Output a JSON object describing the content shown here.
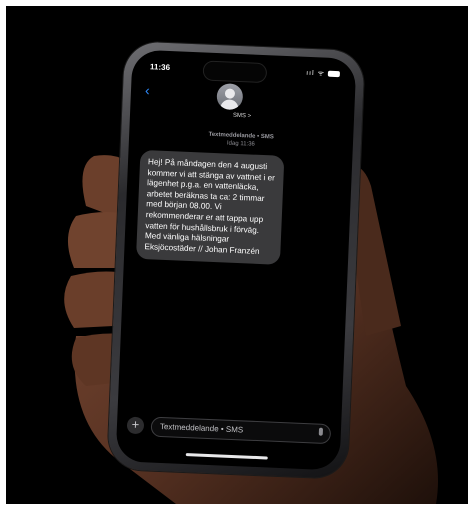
{
  "status_bar": {
    "time": "11:36",
    "icons": "ııl ᯤ"
  },
  "header": {
    "back_icon": "chevron-left-icon",
    "contact_name": "SMS >"
  },
  "thread": {
    "channel": "Textmeddelande • SMS",
    "timestamp": "Idag 11:36"
  },
  "message": {
    "text": "Hej! På måndagen den 4 augusti kommer vi att stänga av vattnet i er lägenhet p.g.a. en vattenläcka, arbetet beräknas ta ca: 2 timmar med början 08.00. Vi rekommenderar er att tappa upp vatten för hushållsbruk i förväg. Med vänliga hälsningar Eksjöcostäder // Johan Franzén"
  },
  "composer": {
    "placeholder": "Textmeddelande • SMS",
    "add_icon": "plus-icon",
    "mic_icon": "mic-icon"
  },
  "colors": {
    "bubble": "#3a3a3c",
    "back": "#2f8cff",
    "background": "#000000"
  }
}
